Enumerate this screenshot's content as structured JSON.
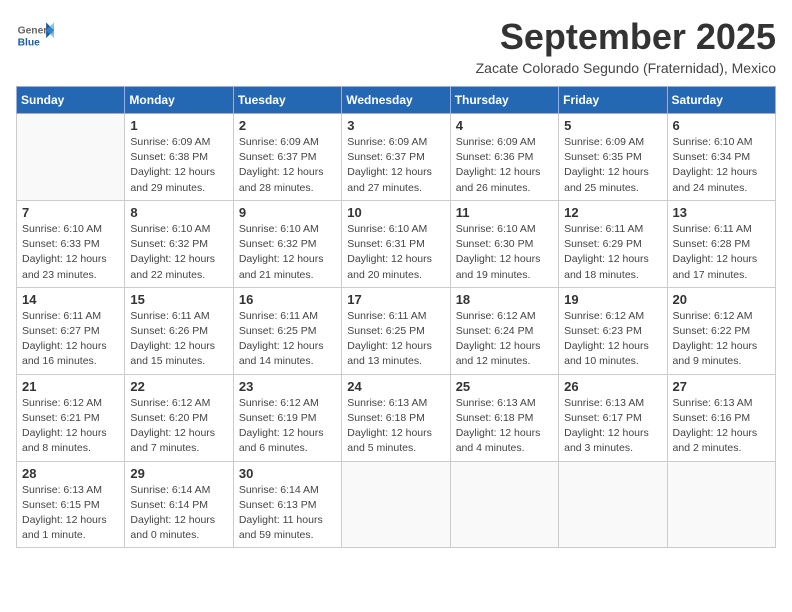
{
  "header": {
    "logo_general": "General",
    "logo_blue": "Blue",
    "month_title": "September 2025",
    "subtitle": "Zacate Colorado Segundo (Fraternidad), Mexico"
  },
  "weekdays": [
    "Sunday",
    "Monday",
    "Tuesday",
    "Wednesday",
    "Thursday",
    "Friday",
    "Saturday"
  ],
  "weeks": [
    [
      {
        "day": "",
        "info": ""
      },
      {
        "day": "1",
        "info": "Sunrise: 6:09 AM\nSunset: 6:38 PM\nDaylight: 12 hours\nand 29 minutes."
      },
      {
        "day": "2",
        "info": "Sunrise: 6:09 AM\nSunset: 6:37 PM\nDaylight: 12 hours\nand 28 minutes."
      },
      {
        "day": "3",
        "info": "Sunrise: 6:09 AM\nSunset: 6:37 PM\nDaylight: 12 hours\nand 27 minutes."
      },
      {
        "day": "4",
        "info": "Sunrise: 6:09 AM\nSunset: 6:36 PM\nDaylight: 12 hours\nand 26 minutes."
      },
      {
        "day": "5",
        "info": "Sunrise: 6:09 AM\nSunset: 6:35 PM\nDaylight: 12 hours\nand 25 minutes."
      },
      {
        "day": "6",
        "info": "Sunrise: 6:10 AM\nSunset: 6:34 PM\nDaylight: 12 hours\nand 24 minutes."
      }
    ],
    [
      {
        "day": "7",
        "info": "Sunrise: 6:10 AM\nSunset: 6:33 PM\nDaylight: 12 hours\nand 23 minutes."
      },
      {
        "day": "8",
        "info": "Sunrise: 6:10 AM\nSunset: 6:32 PM\nDaylight: 12 hours\nand 22 minutes."
      },
      {
        "day": "9",
        "info": "Sunrise: 6:10 AM\nSunset: 6:32 PM\nDaylight: 12 hours\nand 21 minutes."
      },
      {
        "day": "10",
        "info": "Sunrise: 6:10 AM\nSunset: 6:31 PM\nDaylight: 12 hours\nand 20 minutes."
      },
      {
        "day": "11",
        "info": "Sunrise: 6:10 AM\nSunset: 6:30 PM\nDaylight: 12 hours\nand 19 minutes."
      },
      {
        "day": "12",
        "info": "Sunrise: 6:11 AM\nSunset: 6:29 PM\nDaylight: 12 hours\nand 18 minutes."
      },
      {
        "day": "13",
        "info": "Sunrise: 6:11 AM\nSunset: 6:28 PM\nDaylight: 12 hours\nand 17 minutes."
      }
    ],
    [
      {
        "day": "14",
        "info": "Sunrise: 6:11 AM\nSunset: 6:27 PM\nDaylight: 12 hours\nand 16 minutes."
      },
      {
        "day": "15",
        "info": "Sunrise: 6:11 AM\nSunset: 6:26 PM\nDaylight: 12 hours\nand 15 minutes."
      },
      {
        "day": "16",
        "info": "Sunrise: 6:11 AM\nSunset: 6:25 PM\nDaylight: 12 hours\nand 14 minutes."
      },
      {
        "day": "17",
        "info": "Sunrise: 6:11 AM\nSunset: 6:25 PM\nDaylight: 12 hours\nand 13 minutes."
      },
      {
        "day": "18",
        "info": "Sunrise: 6:12 AM\nSunset: 6:24 PM\nDaylight: 12 hours\nand 12 minutes."
      },
      {
        "day": "19",
        "info": "Sunrise: 6:12 AM\nSunset: 6:23 PM\nDaylight: 12 hours\nand 10 minutes."
      },
      {
        "day": "20",
        "info": "Sunrise: 6:12 AM\nSunset: 6:22 PM\nDaylight: 12 hours\nand 9 minutes."
      }
    ],
    [
      {
        "day": "21",
        "info": "Sunrise: 6:12 AM\nSunset: 6:21 PM\nDaylight: 12 hours\nand 8 minutes."
      },
      {
        "day": "22",
        "info": "Sunrise: 6:12 AM\nSunset: 6:20 PM\nDaylight: 12 hours\nand 7 minutes."
      },
      {
        "day": "23",
        "info": "Sunrise: 6:12 AM\nSunset: 6:19 PM\nDaylight: 12 hours\nand 6 minutes."
      },
      {
        "day": "24",
        "info": "Sunrise: 6:13 AM\nSunset: 6:18 PM\nDaylight: 12 hours\nand 5 minutes."
      },
      {
        "day": "25",
        "info": "Sunrise: 6:13 AM\nSunset: 6:18 PM\nDaylight: 12 hours\nand 4 minutes."
      },
      {
        "day": "26",
        "info": "Sunrise: 6:13 AM\nSunset: 6:17 PM\nDaylight: 12 hours\nand 3 minutes."
      },
      {
        "day": "27",
        "info": "Sunrise: 6:13 AM\nSunset: 6:16 PM\nDaylight: 12 hours\nand 2 minutes."
      }
    ],
    [
      {
        "day": "28",
        "info": "Sunrise: 6:13 AM\nSunset: 6:15 PM\nDaylight: 12 hours\nand 1 minute."
      },
      {
        "day": "29",
        "info": "Sunrise: 6:14 AM\nSunset: 6:14 PM\nDaylight: 12 hours\nand 0 minutes."
      },
      {
        "day": "30",
        "info": "Sunrise: 6:14 AM\nSunset: 6:13 PM\nDaylight: 11 hours\nand 59 minutes."
      },
      {
        "day": "",
        "info": ""
      },
      {
        "day": "",
        "info": ""
      },
      {
        "day": "",
        "info": ""
      },
      {
        "day": "",
        "info": ""
      }
    ]
  ]
}
